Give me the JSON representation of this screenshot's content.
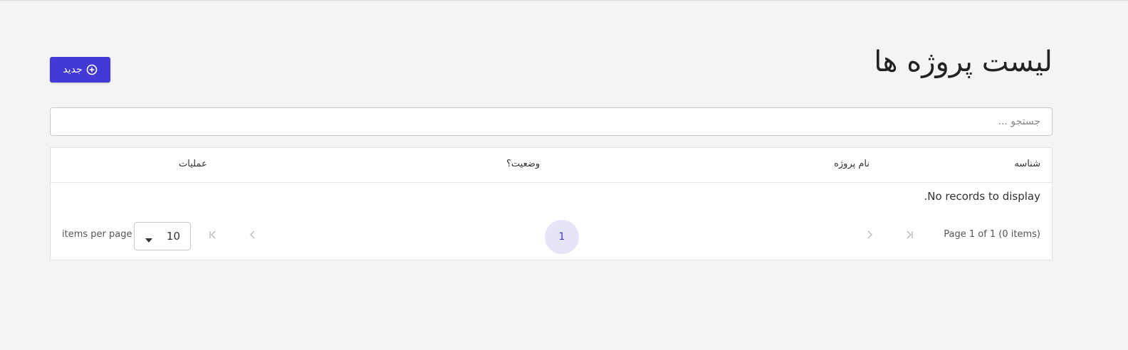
{
  "header": {
    "title": "لیست پروژه ها",
    "new_button_label": "جدید",
    "new_button_icon": "plus-circle-icon"
  },
  "search": {
    "placeholder": "جستجو ..."
  },
  "grid": {
    "columns": [
      "شناسه",
      "نام پروژه",
      "وضعیت؟",
      "عملیات"
    ],
    "rows": [],
    "empty_message": "No records to display."
  },
  "pager": {
    "info": "Page 1 of 1 (0 items)",
    "current_page": "1",
    "page_size": "10",
    "items_per_page_label": "items per page"
  },
  "colors": {
    "accent": "#4339d6",
    "page_highlight": "#e6e4f8",
    "background": "#f4f4f4"
  }
}
